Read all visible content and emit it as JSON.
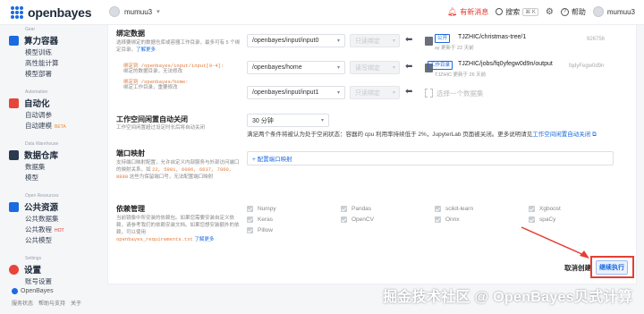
{
  "app": {
    "brand": "openbayes"
  },
  "topbar": {
    "username": "mumuu3",
    "notice": "有新消息",
    "search": "搜索",
    "search_kbd": "⌘ K",
    "help": "帮助",
    "account": "mumuu3"
  },
  "sidebar": {
    "sections": [
      {
        "caption": "Gear",
        "title": "算力容器",
        "items": [
          {
            "label": "模型训练"
          },
          {
            "label": "高性能计算"
          },
          {
            "label": "模型部署"
          }
        ]
      },
      {
        "caption": "Automation",
        "title": "自动化",
        "items": [
          {
            "label": "自动调参"
          },
          {
            "label": "自动建模",
            "badge": "BETA"
          }
        ]
      },
      {
        "caption": "Data Warehouse",
        "title": "数据仓库",
        "items": [
          {
            "label": "数据集"
          },
          {
            "label": "模型"
          }
        ]
      },
      {
        "caption": "Open Resources",
        "title": "公共资源",
        "items": [
          {
            "label": "公共数据集"
          },
          {
            "label": "公共教程",
            "badge": "HOT"
          },
          {
            "label": "公共模型"
          }
        ]
      },
      {
        "caption": "Settings",
        "title": "设置",
        "items": [
          {
            "label": "账号设置"
          }
        ]
      }
    ],
    "footer_brand": "OpenBayes",
    "footer_links": [
      "服务状态",
      "帮助与支持",
      "关于"
    ]
  },
  "bind": {
    "title": "绑定数据",
    "desc": "选择要绑定的数据仓库或容器工作目录，最多可有 5 个绑定目录。",
    "desc_link": "了解更多",
    "warn1": "绑定到 /openbayes/input/input[0-4]:",
    "warn1b": "绑定的数据目录，无法修改",
    "warn2": "绑定到 /openbayes/home:",
    "warn2b": "绑定工作目录，重要修改",
    "rows": [
      {
        "path": "/openbayes/input/input0",
        "select": "只读绑定",
        "tag": "公开",
        "name": "TJZHIC/christmas-tree/1",
        "meta": "更新于 22 天前",
        "user": "sy",
        "id": "926756"
      },
      {
        "path": "/openbayes/home",
        "select": "读写绑定",
        "tag": "工作目录",
        "name": "TJZHIC/jobs/fq0yfegw0d9n/output",
        "meta": "更新于 26 天前",
        "user": "TJZHIC",
        "id": "fqdyFegw0d9n"
      },
      {
        "path": "/openbayes/input/input1",
        "select": "只读绑定",
        "placeholder": "选择一个数据集"
      }
    ]
  },
  "idle": {
    "title": "工作空间闲置自动关闭",
    "desc": "工作空间闲置超过设定时长后将自动关闭",
    "value": "30 分钟",
    "hint": "满足两个条件将被认为处于空闲状态：容器的 cpu 利用率持续低于 2%，JupyterLab 页面被关闭。更多说明请见",
    "hint_link": "工作空间闲置自动关闭"
  },
  "ports": {
    "title": "端口映射",
    "desc": "支持端口映射配置，允许自定义内部服务与外部访问端口的映射关系，如",
    "desc_ports": "22, 5901, 6006, 6637, 7860, 8888",
    "desc_tail": "这些为保留端口号，无法配置端口映射",
    "button": "+ 配置端口映射"
  },
  "deps": {
    "title": "依赖管理",
    "desc": "当前镜像中所安装的依赖包。如果您需要安装自定义依赖，请参考我们的依赖安装文档。如果您想安装额外的依赖，可以使用",
    "desc_file": "openbayes_requirements.txt",
    "desc_link": "了解更多",
    "items": [
      "Numpy",
      "Pandas",
      "scikit-learn",
      "Xgboost",
      "Keras",
      "OpenCV",
      "Onnx",
      "spaCy",
      "Pillow"
    ]
  },
  "actions": {
    "cancel": "取消创建",
    "submit": "继续执行"
  },
  "watermark": "掘金技术社区 @ OpenBayes贝式计算",
  "colors": {
    "accent": "#1a6be0",
    "warning": "#e07a3a",
    "highlight": "#e53f32"
  }
}
